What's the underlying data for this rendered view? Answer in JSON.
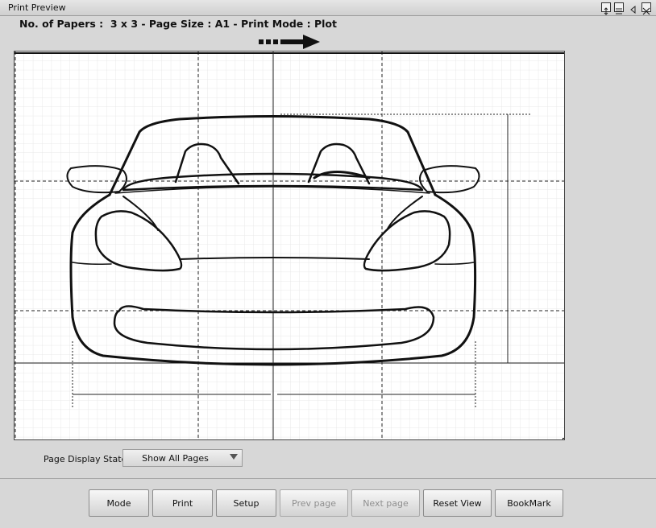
{
  "window": {
    "title": "Print Preview"
  },
  "info": {
    "text": "No. of Papers :  3 x 3 - Page Size : A1 - Print Mode : Plot"
  },
  "page_display": {
    "label": "Page Display State",
    "selected": "Show All Pages"
  },
  "buttons": {
    "mode": "Mode",
    "print": "Print",
    "setup": "Setup",
    "prev_page": "Prev page",
    "next_page": "Next page",
    "reset_view": "Reset View",
    "bookmark": "BookMark"
  }
}
